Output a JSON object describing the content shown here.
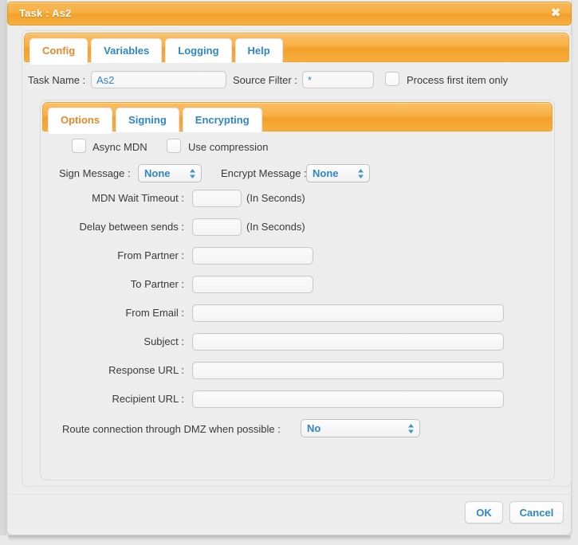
{
  "window": {
    "title": "Task : As2",
    "close_label": "✖"
  },
  "outer_tabs": [
    {
      "label": "Config",
      "active": true
    },
    {
      "label": "Variables",
      "active": false
    },
    {
      "label": "Logging",
      "active": false
    },
    {
      "label": "Help",
      "active": false
    }
  ],
  "config_row": {
    "task_name_label": "Task Name :",
    "task_name_value": "As2",
    "source_filter_label": "Source Filter :",
    "source_filter_value": "*",
    "process_first_label": "Process first item only",
    "process_first_checked": false
  },
  "inner_tabs": [
    {
      "label": "Options",
      "active": true
    },
    {
      "label": "Signing",
      "active": false
    },
    {
      "label": "Encrypting",
      "active": false
    }
  ],
  "options": {
    "async_mdn_label": "Async MDN",
    "async_mdn_checked": false,
    "use_compression_label": "Use compression",
    "use_compression_checked": false,
    "sign_message_label": "Sign Message :",
    "sign_message_value": "None",
    "encrypt_message_label": "Encrypt Message :",
    "encrypt_message_value": "None",
    "mdn_wait_timeout_label": "MDN Wait Timeout :",
    "mdn_wait_timeout_value": "",
    "mdn_wait_timeout_suffix": "(In Seconds)",
    "delay_between_sends_label": "Delay between sends :",
    "delay_between_sends_value": "",
    "delay_between_sends_suffix": "(In Seconds)",
    "from_partner_label": "From Partner :",
    "from_partner_value": "",
    "to_partner_label": "To Partner :",
    "to_partner_value": "",
    "from_email_label": "From Email :",
    "from_email_value": "",
    "subject_label": "Subject :",
    "subject_value": "",
    "response_url_label": "Response URL :",
    "response_url_value": "",
    "recipient_url_label": "Recipient URL :",
    "recipient_url_value": "",
    "dmz_label": "Route connection through DMZ when possible :",
    "dmz_value": "No"
  },
  "footer": {
    "ok_label": "OK",
    "cancel_label": "Cancel"
  },
  "colors": {
    "accent_orange": "#f6ae40",
    "link_blue": "#2f86c5",
    "active_tab_orange": "#e8882a",
    "panel_bg": "#ededed"
  }
}
